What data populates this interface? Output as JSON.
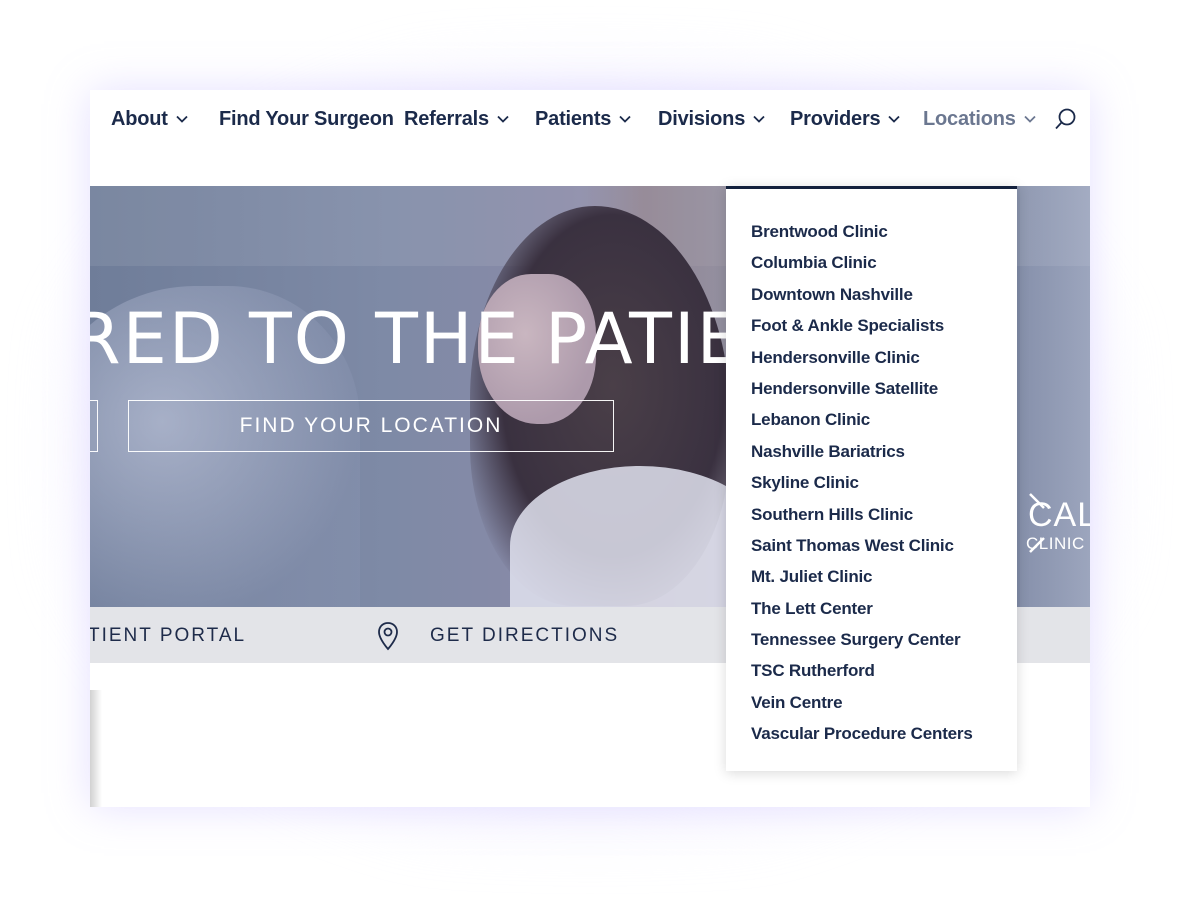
{
  "nav": {
    "items": [
      {
        "label": "About",
        "has_dropdown": true
      },
      {
        "label": "Find Your Surgeon",
        "has_dropdown": false
      },
      {
        "label": "Referrals",
        "has_dropdown": true
      },
      {
        "label": "Patients",
        "has_dropdown": true
      },
      {
        "label": "Divisions",
        "has_dropdown": true
      },
      {
        "label": "Providers",
        "has_dropdown": true
      },
      {
        "label": "Locations",
        "has_dropdown": true,
        "active": true
      }
    ],
    "search_icon": "search-icon"
  },
  "hero": {
    "title": "RED TO THE PATIENT",
    "find_location_button": "FIND YOUR LOCATION",
    "logo_line1": "CAL",
    "logo_line2": "CLINIC"
  },
  "portal_bar": {
    "patient_portal": "TIENT PORTAL",
    "get_directions": "GET DIRECTIONS",
    "pin_icon": "map-pin-icon"
  },
  "locations_dropdown": {
    "items": [
      "Brentwood Clinic",
      "Columbia Clinic",
      "Downtown Nashville",
      "Foot & Ankle Specialists",
      "Hendersonville Clinic",
      "Hendersonville Satellite",
      "Lebanon Clinic",
      "Nashville Bariatrics",
      "Skyline Clinic",
      "Southern Hills Clinic",
      "Saint Thomas West Clinic",
      "Mt. Juliet Clinic",
      "The Lett Center",
      "Tennessee Surgery Center",
      "TSC Rutherford",
      "Vein Centre",
      "Vascular Procedure Centers"
    ]
  },
  "colors": {
    "nav_text": "#1b2a4a",
    "nav_active": "#6b7790",
    "dropdown_border": "#13213d",
    "portal_bar_bg": "#e3e4e8"
  }
}
